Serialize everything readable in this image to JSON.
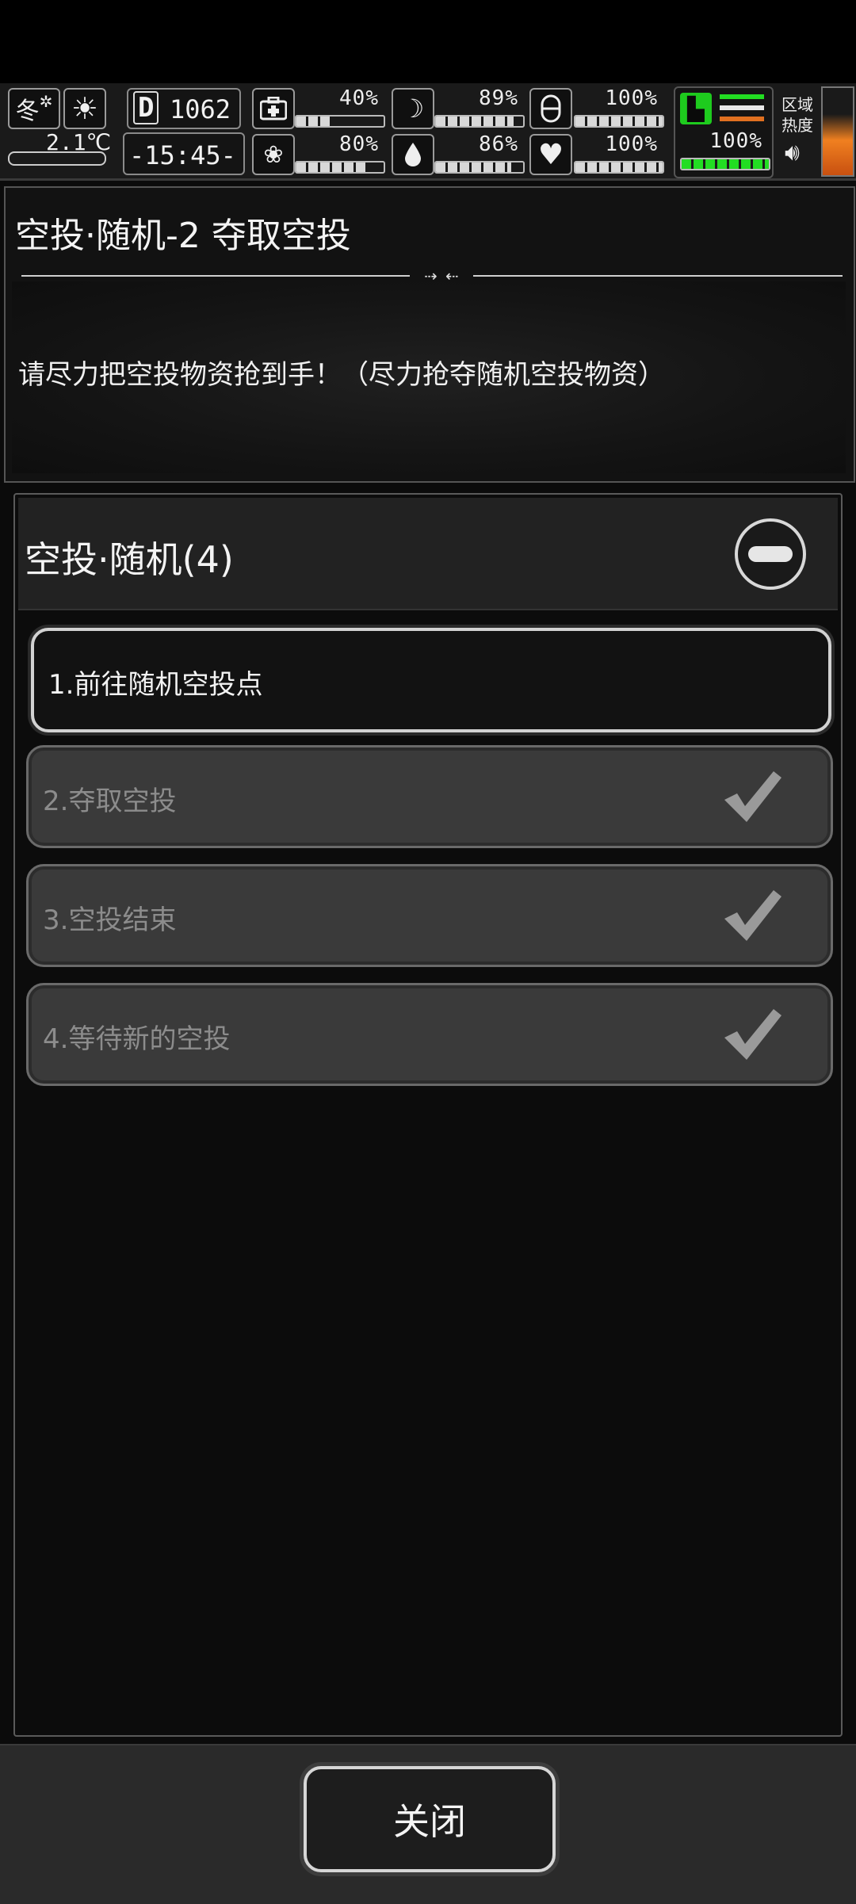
{
  "hud": {
    "season": "冬",
    "temperature": "2.1℃",
    "day_label": "D",
    "day_number": "1062",
    "time": "-15:45-",
    "stats": [
      {
        "icon": "medkit-icon",
        "value": "40%",
        "fill": 0.4
      },
      {
        "icon": "stomach-icon",
        "value": "89%",
        "fill": 0.89
      },
      {
        "icon": "pill-icon",
        "value": "100%",
        "fill": 1.0
      },
      {
        "icon": "brain-icon",
        "value": "80%",
        "fill": 0.8
      },
      {
        "icon": "water-drop-icon",
        "value": "86%",
        "fill": 0.86
      },
      {
        "icon": "heart-icon",
        "value": "100%",
        "fill": 1.0
      }
    ],
    "stamina": "100%",
    "zone_heat_label_1": "区域",
    "zone_heat_label_2": "热度",
    "colors": {
      "stamina_green": "#22dd22",
      "heat_orange": "#e07020"
    }
  },
  "mission": {
    "title": "空投·随机-2 夺取空投",
    "description": "请尽力把空投物资抢到手！（尽力抢夺随机空投物资）"
  },
  "quest": {
    "title": "空投·随机(4)",
    "steps": [
      {
        "label": "1.前往随机空投点",
        "state": "active"
      },
      {
        "label": "2.夺取空投",
        "state": "done"
      },
      {
        "label": "3.空投结束",
        "state": "done"
      },
      {
        "label": "4.等待新的空投",
        "state": "done"
      }
    ]
  },
  "footer": {
    "close_label": "关闭"
  }
}
